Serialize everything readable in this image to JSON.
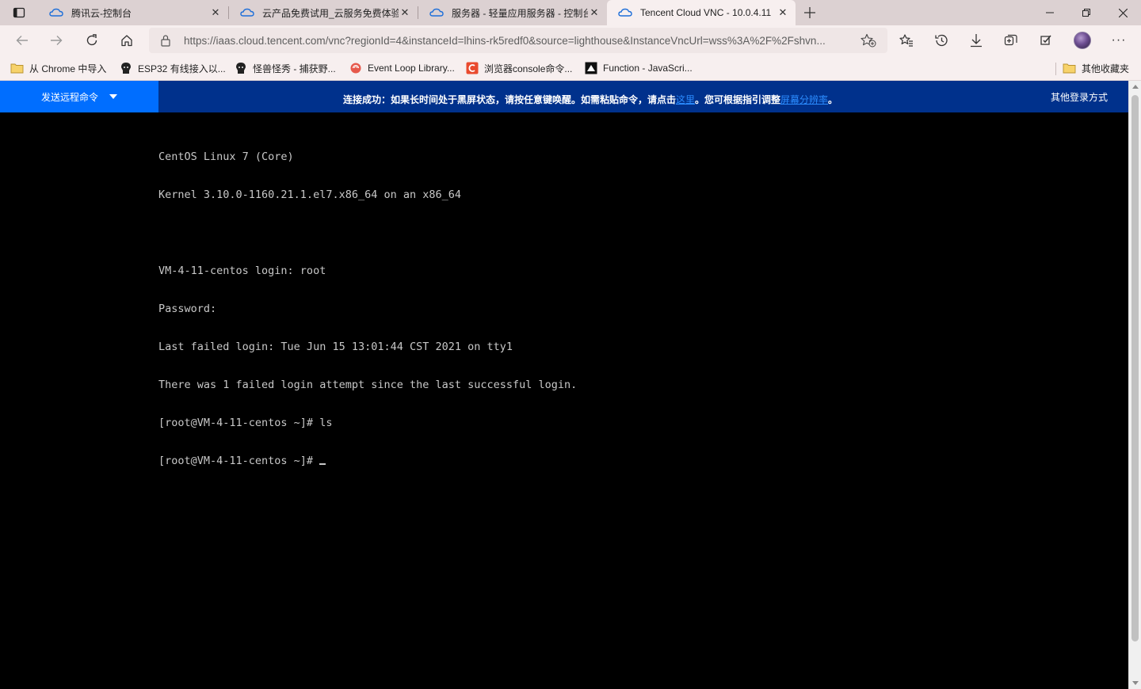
{
  "browser": {
    "tabs": [
      {
        "title": "腾讯云-控制台",
        "icon": "tencent-cloud-icon",
        "active": false
      },
      {
        "title": "云产品免费试用_云服务免费体验",
        "icon": "tencent-cloud-icon",
        "active": false
      },
      {
        "title": "服务器 - 轻量应用服务器 - 控制台",
        "icon": "tencent-cloud-icon",
        "active": false
      },
      {
        "title": "Tencent Cloud VNC - 10.0.4.11",
        "icon": "tencent-cloud-icon",
        "active": true
      }
    ],
    "address": {
      "url": "https://iaas.cloud.tencent.com/vnc?regionId=4&instanceId=lhins-rk5redf0&source=lighthouse&InstanceVncUrl=wss%3A%2F%2Fshvn..."
    },
    "bookmarks": [
      {
        "label": "从 Chrome 中导入",
        "icon": "folder-icon"
      },
      {
        "label": "ESP32 有线接入以...",
        "icon": "hacker-icon"
      },
      {
        "label": "怪兽怪秀 - 捕获野...",
        "icon": "hacker-icon"
      },
      {
        "label": "Event Loop Library...",
        "icon": "lib-icon"
      },
      {
        "label": "浏览器console命令...",
        "icon": "csdn-icon"
      },
      {
        "label": "Function - JavaScri...",
        "icon": "mdn-icon"
      }
    ],
    "other_bookmarks": "其他收藏夹"
  },
  "vnc": {
    "send_command": "发送远程命令",
    "notice_pre": "连接成功：如果长时间处于黑屏状态，请按任意键唤醒。如需粘贴命令，请点击",
    "notice_link1": "这里",
    "notice_mid": "。您可根据指引调整",
    "notice_link2": "屏幕分辨率",
    "notice_post": "。",
    "other_login": "其他登录方式",
    "colors": {
      "send_button": "#006eff",
      "header": "#00318c",
      "link": "#2b8cff"
    }
  },
  "terminal": {
    "lines": [
      "CentOS Linux 7 (Core)",
      "Kernel 3.10.0-1160.21.1.el7.x86_64 on an x86_64",
      "",
      "VM-4-11-centos login: root",
      "Password:",
      "Last failed login: Tue Jun 15 13:01:44 CST 2021 on tty1",
      "There was 1 failed login attempt since the last successful login.",
      "[root@VM-4-11-centos ~]# ls"
    ],
    "prompt": "[root@VM-4-11-centos ~]# "
  }
}
